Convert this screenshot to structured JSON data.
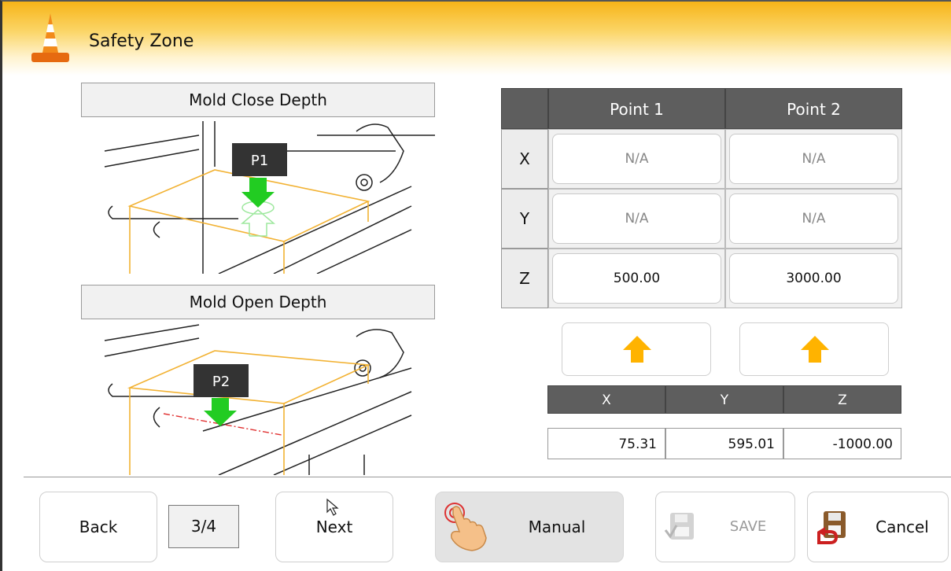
{
  "header": {
    "title": "Safety Zone",
    "icon": "traffic-cone-icon"
  },
  "illustrations": {
    "close": {
      "label": "Mold Close Depth",
      "marker": "P1"
    },
    "open": {
      "label": "Mold Open Depth",
      "marker": "P2"
    }
  },
  "points_table": {
    "columns": [
      "Point 1",
      "Point 2"
    ],
    "rows": [
      {
        "axis": "X",
        "p1": "N/A",
        "p2": "N/A"
      },
      {
        "axis": "Y",
        "p1": "N/A",
        "p2": "N/A"
      },
      {
        "axis": "Z",
        "p1": "500.00",
        "p2": "3000.00"
      }
    ]
  },
  "current_position": {
    "headers": [
      "X",
      "Y",
      "Z"
    ],
    "values": [
      "75.31",
      "595.01",
      "-1000.00"
    ]
  },
  "footer": {
    "back": "Back",
    "page": "3/4",
    "next": "Next",
    "manual": "Manual",
    "save": "SAVE",
    "cancel": "Cancel"
  },
  "colors": {
    "header_top": "#f7b418",
    "accent_arrow": "#ffb300",
    "marker_green": "#22cc22",
    "table_header": "#5e5e5e"
  }
}
